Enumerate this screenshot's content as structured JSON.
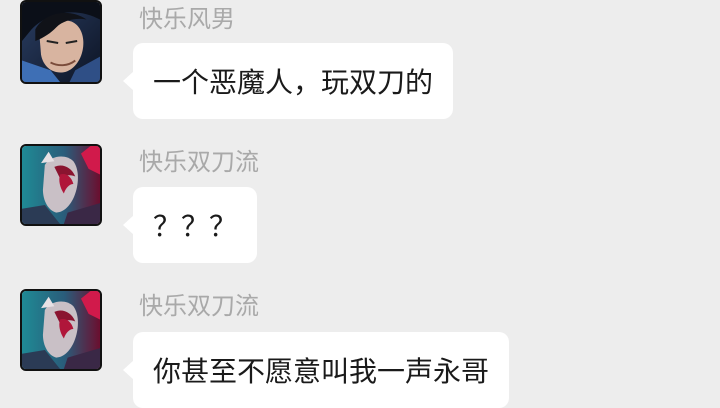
{
  "messages": [
    {
      "sender": "快乐风男",
      "text": "一个恶魔人，玩双刀的",
      "avatar_icon": "yasuo-avatar-icon"
    },
    {
      "sender": "快乐双刀流",
      "text": "？？？",
      "avatar_icon": "yone-avatar-icon"
    },
    {
      "sender": "快乐双刀流",
      "text": "你甚至不愿意叫我一声永哥",
      "avatar_icon": "yone-avatar-icon"
    }
  ],
  "colors": {
    "background": "#ededed",
    "bubble": "#ffffff",
    "sender_name": "#a9a9a9",
    "message_text": "#1a1a1a"
  }
}
